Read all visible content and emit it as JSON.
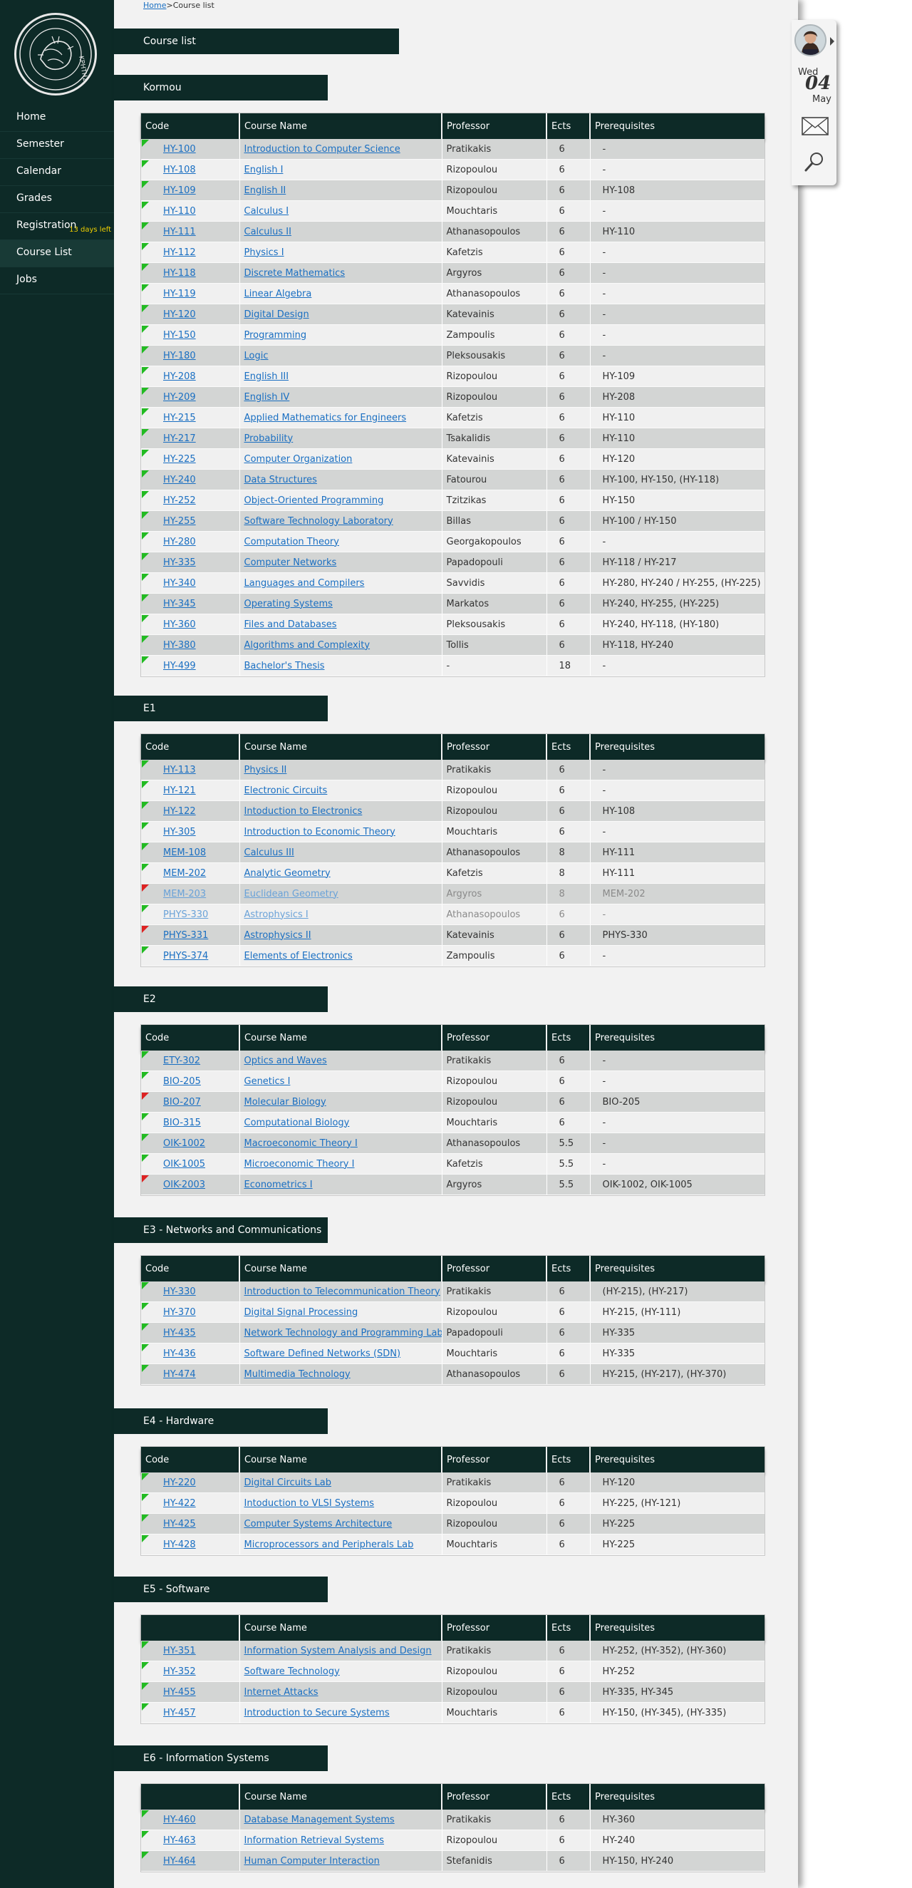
{
  "sidebar": {
    "logo_text": "ΚΡΗΤΗΣ",
    "items": [
      {
        "label": "Home"
      },
      {
        "label": "Semester"
      },
      {
        "label": "Calendar"
      },
      {
        "label": "Grades"
      },
      {
        "label": "Registration",
        "note": "13 days left"
      },
      {
        "label": "Course List"
      },
      {
        "label": "Jobs"
      }
    ]
  },
  "breadcrumb": {
    "home": "Home",
    "sep": ">",
    "current": "Course list"
  },
  "page_title": "Course list",
  "columns": [
    "Code",
    "Course Name",
    "Professor",
    "Ects",
    "Prerequisites"
  ],
  "colors": {
    "dark": "#0d2a27",
    "link": "#1a6fc2",
    "row_odd": "#d3d5d4",
    "row_even": "#f0f0f0",
    "ok": "#22bb22",
    "blocked": "#dd2222",
    "note": "#f0d000"
  },
  "sections": [
    {
      "title": "Kormou",
      "code_header": true,
      "rows": [
        {
          "code": "HY-100",
          "name": "Introduction to Computer Science",
          "prof": "Pratikakis",
          "ects": "6",
          "prereq": "-",
          "mark": "green"
        },
        {
          "code": "HY-108",
          "name": "English I",
          "prof": "Rizopoulou",
          "ects": "6",
          "prereq": "-",
          "mark": "green"
        },
        {
          "code": "HY-109",
          "name": "English II",
          "prof": "Rizopoulou",
          "ects": "6",
          "prereq": "HY-108",
          "mark": "green"
        },
        {
          "code": "HY-110",
          "name": "Calculus I",
          "prof": "Mouchtaris",
          "ects": "6",
          "prereq": "-",
          "mark": "green"
        },
        {
          "code": "HY-111",
          "name": "Calculus II",
          "prof": "Athanasopoulos",
          "ects": "6",
          "prereq": "HY-110",
          "mark": "green"
        },
        {
          "code": "HY-112",
          "name": "Physics I",
          "prof": "Kafetzis",
          "ects": "6",
          "prereq": "-",
          "mark": "green"
        },
        {
          "code": "HY-118",
          "name": "Discrete Mathematics",
          "prof": "Argyros",
          "ects": "6",
          "prereq": "-",
          "mark": "green"
        },
        {
          "code": "HY-119",
          "name": "Linear Algebra",
          "prof": "Athanasopoulos",
          "ects": "6",
          "prereq": "-",
          "mark": "green"
        },
        {
          "code": "HY-120",
          "name": "Digital Design",
          "prof": "Katevainis",
          "ects": "6",
          "prereq": "-",
          "mark": "green"
        },
        {
          "code": "HY-150",
          "name": "Programming",
          "prof": "Zampoulis",
          "ects": "6",
          "prereq": "-",
          "mark": "green"
        },
        {
          "code": "HY-180",
          "name": "Logic",
          "prof": "Pleksousakis",
          "ects": "6",
          "prereq": "-",
          "mark": "green"
        },
        {
          "code": "HY-208",
          "name": "English III",
          "prof": "Rizopoulou",
          "ects": "6",
          "prereq": "HY-109",
          "mark": "green"
        },
        {
          "code": "HY-209",
          "name": "English IV",
          "prof": "Rizopoulou",
          "ects": "6",
          "prereq": "HY-208",
          "mark": "green"
        },
        {
          "code": "HY-215",
          "name": "Applied Mathematics for Engineers",
          "prof": "Kafetzis",
          "ects": "6",
          "prereq": "HY-110",
          "mark": "green"
        },
        {
          "code": "HY-217",
          "name": "Probability",
          "prof": "Tsakalidis",
          "ects": "6",
          "prereq": "HY-110",
          "mark": "green"
        },
        {
          "code": "HY-225",
          "name": "Computer Organization",
          "prof": "Katevainis",
          "ects": "6",
          "prereq": "HY-120",
          "mark": "green"
        },
        {
          "code": "HY-240",
          "name": "Data Structures",
          "prof": "Fatourou",
          "ects": "6",
          "prereq": "HY-100, HY-150, (HY-118)",
          "mark": "green"
        },
        {
          "code": "HY-252",
          "name": "Object-Oriented Programming",
          "prof": "Tzitzikas",
          "ects": "6",
          "prereq": "HY-150",
          "mark": "green"
        },
        {
          "code": "HY-255",
          "name": "Software Technology Laboratory",
          "prof": "Billas",
          "ects": "6",
          "prereq": "HY-100 / HY-150",
          "mark": "green"
        },
        {
          "code": "HY-280",
          "name": "Computation Theory",
          "prof": "Georgakopoulos",
          "ects": "6",
          "prereq": "-",
          "mark": "green"
        },
        {
          "code": "HY-335",
          "name": "Computer Networks",
          "prof": "Papadopouli",
          "ects": "6",
          "prereq": "HY-118 / HY-217",
          "mark": "green"
        },
        {
          "code": "HY-340",
          "name": "Languages and Compilers",
          "prof": "Savvidis",
          "ects": "6",
          "prereq": "HY-280, HY-240 / HY-255, (HY-225)",
          "mark": "green"
        },
        {
          "code": "HY-345",
          "name": "Operating Systems",
          "prof": "Markatos",
          "ects": "6",
          "prereq": "HY-240, HY-255, (HY-225)",
          "mark": "green"
        },
        {
          "code": "HY-360",
          "name": "Files and Databases",
          "prof": "Pleksousakis",
          "ects": "6",
          "prereq": "HY-240, HY-118, (HY-180)",
          "mark": "green"
        },
        {
          "code": "HY-380",
          "name": "Algorithms and Complexity",
          "prof": "Tollis",
          "ects": "6",
          "prereq": "HY-118, HY-240",
          "mark": "green"
        },
        {
          "code": "HY-499",
          "name": "Bachelor's Thesis",
          "prof": "-",
          "ects": "18",
          "prereq": "-",
          "mark": "green"
        }
      ]
    },
    {
      "title": "E1",
      "code_header": true,
      "rows": [
        {
          "code": "HY-113",
          "name": "Physics II",
          "prof": "Pratikakis",
          "ects": "6",
          "prereq": "-",
          "mark": "green"
        },
        {
          "code": "HY-121",
          "name": "Electronic Circuits",
          "prof": "Rizopoulou",
          "ects": "6",
          "prereq": "-",
          "mark": "green"
        },
        {
          "code": "HY-122",
          "name": "Intoduction to Electronics",
          "prof": "Rizopoulou",
          "ects": "6",
          "prereq": "HY-108",
          "mark": "green"
        },
        {
          "code": "HY-305",
          "name": "Introduction to Economic Theory",
          "prof": "Mouchtaris",
          "ects": "6",
          "prereq": "-",
          "mark": "green"
        },
        {
          "code": "MEM-108",
          "name": "Calculus III",
          "prof": "Athanasopoulos",
          "ects": "8",
          "prereq": "HY-111",
          "mark": "green"
        },
        {
          "code": "MEM-202",
          "name": "Analytic Geometry",
          "prof": "Kafetzis",
          "ects": "8",
          "prereq": "HY-111",
          "mark": "green"
        },
        {
          "code": "MEM-203",
          "name": "Euclidean Geometry",
          "prof": "Argyros",
          "ects": "8",
          "prereq": "MEM-202",
          "mark": "red",
          "faded": true
        },
        {
          "code": "PHYS-330",
          "name": "Astrophysics I",
          "prof": "Athanasopoulos",
          "ects": "6",
          "prereq": "-",
          "mark": "green",
          "faded": true
        },
        {
          "code": "PHYS-331",
          "name": "Astrophysics II",
          "prof": "Katevainis",
          "ects": "6",
          "prereq": "PHYS-330",
          "mark": "red"
        },
        {
          "code": "PHYS-374",
          "name": "Elements of Electronics",
          "prof": "Zampoulis",
          "ects": "6",
          "prereq": "-",
          "mark": "green"
        }
      ]
    },
    {
      "title": "E2",
      "code_header": true,
      "rows": [
        {
          "code": "ETY-302",
          "name": "Optics and Waves",
          "prof": "Pratikakis",
          "ects": "6",
          "prereq": "-",
          "mark": "green"
        },
        {
          "code": "BIO-205",
          "name": "Genetics I",
          "prof": "Rizopoulou",
          "ects": "6",
          "prereq": "-",
          "mark": "green"
        },
        {
          "code": "BIO-207",
          "name": "Molecular Biology",
          "prof": "Rizopoulou",
          "ects": "6",
          "prereq": "BIO-205",
          "mark": "red"
        },
        {
          "code": "BIO-315",
          "name": "Computational Biology",
          "prof": "Mouchtaris",
          "ects": "6",
          "prereq": "-",
          "mark": "green"
        },
        {
          "code": "OIK-1002",
          "name": "Macroeconomic Theory I",
          "prof": "Athanasopoulos",
          "ects": "5.5",
          "prereq": "-",
          "mark": "green"
        },
        {
          "code": "OIK-1005",
          "name": "Microeconomic Theory I",
          "prof": "Kafetzis",
          "ects": "5.5",
          "prereq": "-",
          "mark": "green"
        },
        {
          "code": "OIK-2003",
          "name": "Econometrics I",
          "prof": "Argyros",
          "ects": "5.5",
          "prereq": "OIK-1002, OIK-1005",
          "mark": "red"
        }
      ]
    },
    {
      "title": "E3 - Networks and Communications",
      "code_header": true,
      "rows": [
        {
          "code": "HY-330",
          "name": "Introduction to Telecommunication Theory",
          "prof": "Pratikakis",
          "ects": "6",
          "prereq": "(HY-215), (HY-217)",
          "mark": "green"
        },
        {
          "code": "HY-370",
          "name": "Digital Signal Processing",
          "prof": "Rizopoulou",
          "ects": "6",
          "prereq": "HY-215, (HY-111)",
          "mark": "green"
        },
        {
          "code": "HY-435",
          "name": "Network Technology and Programming Lab",
          "prof": "Papadopouli",
          "ects": "6",
          "prereq": "HY-335",
          "mark": "green"
        },
        {
          "code": "HY-436",
          "name": "Software Defined Networks (SDN)",
          "prof": "Mouchtaris",
          "ects": "6",
          "prereq": "HY-335",
          "mark": "green"
        },
        {
          "code": "HY-474",
          "name": "Multimedia Technology",
          "prof": "Athanasopoulos",
          "ects": "6",
          "prereq": "HY-215, (HY-217), (HY-370)",
          "mark": "green"
        }
      ]
    },
    {
      "title": "E4 - Hardware",
      "code_header": true,
      "rows": [
        {
          "code": "HY-220",
          "name": "Digital Circuits Lab",
          "prof": "Pratikakis",
          "ects": "6",
          "prereq": "HY-120",
          "mark": "green"
        },
        {
          "code": "HY-422",
          "name": "Intoduction to VLSI Systems",
          "prof": "Rizopoulou",
          "ects": "6",
          "prereq": "HY-225, (HY-121)",
          "mark": "green"
        },
        {
          "code": "HY-425",
          "name": "Computer Systems Architecture",
          "prof": "Rizopoulou",
          "ects": "6",
          "prereq": "HY-225",
          "mark": "green"
        },
        {
          "code": "HY-428",
          "name": "Microprocessors and Peripherals Lab",
          "prof": "Mouchtaris",
          "ects": "6",
          "prereq": "HY-225",
          "mark": "green"
        }
      ]
    },
    {
      "title": "E5 - Software",
      "code_header": false,
      "rows": [
        {
          "code": "HY-351",
          "name": "Information System Analysis and Design",
          "prof": "Pratikakis",
          "ects": "6",
          "prereq": "HY-252, (HY-352), (HY-360)",
          "mark": "green"
        },
        {
          "code": "HY-352",
          "name": "Software Technology",
          "prof": "Rizopoulou",
          "ects": "6",
          "prereq": "HY-252",
          "mark": "green"
        },
        {
          "code": "HY-455",
          "name": "Internet Attacks",
          "prof": "Rizopoulou",
          "ects": "6",
          "prereq": "HY-335, HY-345",
          "mark": "green"
        },
        {
          "code": "HY-457",
          "name": "Introduction to Secure Systems",
          "prof": "Mouchtaris",
          "ects": "6",
          "prereq": "HY-150, (HY-345), (HY-335)",
          "mark": "green"
        }
      ]
    },
    {
      "title": "E6 - Information Systems",
      "code_header": false,
      "rows": [
        {
          "code": "HY-460",
          "name": "Database Management Systems",
          "prof": "Pratikakis",
          "ects": "6",
          "prereq": "HY-360",
          "mark": "green"
        },
        {
          "code": "HY-463",
          "name": "Information Retrieval Systems",
          "prof": "Rizopoulou",
          "ects": "6",
          "prereq": "HY-240",
          "mark": "green"
        },
        {
          "code": "HY-464",
          "name": "Human Computer Interaction",
          "prof": "Stefanidis",
          "ects": "6",
          "prereq": "HY-150, HY-240",
          "mark": "green"
        }
      ]
    }
  ],
  "widget": {
    "weekday": "Wed",
    "day": "04",
    "month": "May",
    "avatar_icon": "user-avatar",
    "mail_icon": "mail-icon",
    "search_icon": "search-icon"
  }
}
